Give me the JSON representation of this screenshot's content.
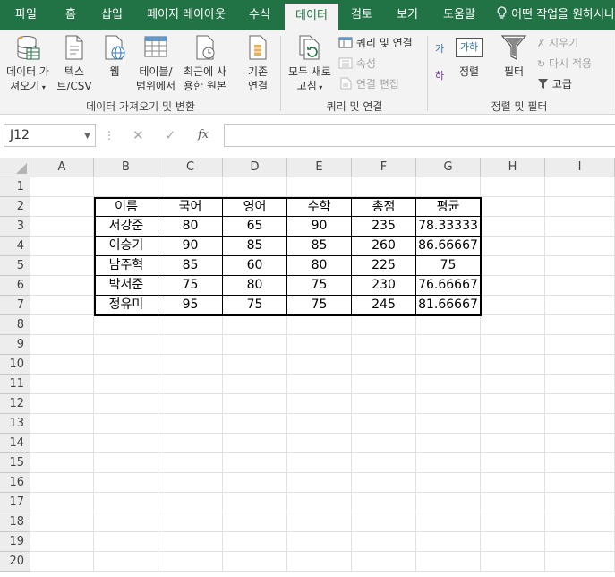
{
  "tabs": [
    "파일",
    "홈",
    "삽입",
    "페이지 레이아웃",
    "수식",
    "데이터",
    "검토",
    "보기",
    "도움말"
  ],
  "tell_me": "어떤 작업을 원하시나",
  "ribbon": {
    "get_data_l1": "데이터 가",
    "get_data_l2": "져오기",
    "text_csv_l1": "텍스",
    "text_csv_l2": "트/CSV",
    "web": "웹",
    "from_table_l1": "테이블/",
    "from_table_l2": "범위에서",
    "recent_l1": "최근에 사",
    "recent_l2": "용한 원본",
    "existing_l1": "기존",
    "existing_l2": "연결",
    "group_get": "데이터 가져오기 및 변환",
    "refresh_l1": "모두 새로",
    "refresh_l2": "고침",
    "queries": "쿼리 및 연결",
    "properties": "속성",
    "edit_links": "연결 편집",
    "group_queries": "쿼리 및 연결",
    "sort_az": "가",
    "sort_za": "하",
    "sort_btn_top": "가하",
    "sort": "정렬",
    "filter": "필터",
    "clear": "지우기",
    "reapply": "다시 적용",
    "advanced": "고급",
    "group_sort": "정렬 및 필터"
  },
  "formula_bar": {
    "name_box": "J12",
    "formula": ""
  },
  "columns": [
    "A",
    "B",
    "C",
    "D",
    "E",
    "F",
    "G",
    "H",
    "I"
  ],
  "rows": [
    "1",
    "2",
    "3",
    "4",
    "5",
    "6",
    "7",
    "8",
    "9",
    "10",
    "11",
    "12",
    "13",
    "14",
    "15",
    "16",
    "17",
    "18",
    "19",
    "20"
  ],
  "table": {
    "headers": [
      "이름",
      "국어",
      "영어",
      "수학",
      "총점",
      "평균"
    ],
    "rows": [
      [
        "서강준",
        "80",
        "65",
        "90",
        "235",
        "78.33333"
      ],
      [
        "이승기",
        "90",
        "85",
        "85",
        "260",
        "86.66667"
      ],
      [
        "남주혁",
        "85",
        "60",
        "80",
        "225",
        "75"
      ],
      [
        "박서준",
        "75",
        "80",
        "75",
        "230",
        "76.66667"
      ],
      [
        "정유미",
        "95",
        "75",
        "75",
        "245",
        "81.66667"
      ]
    ]
  },
  "colors": {
    "accent": "#217346",
    "ribbon_bg": "#f3f3f3"
  }
}
